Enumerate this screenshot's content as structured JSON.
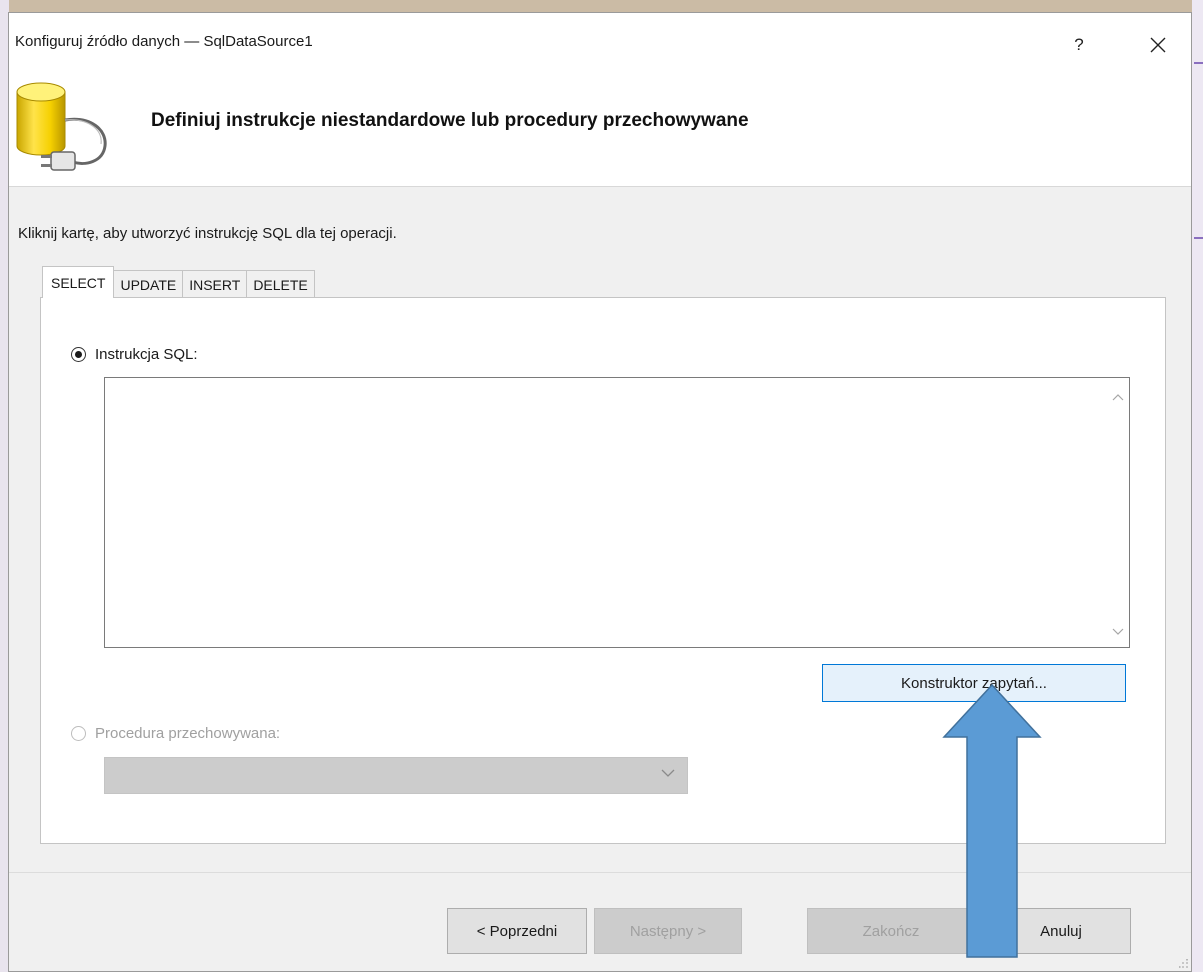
{
  "window": {
    "title": "Konfiguruj źródło danych — SqlDataSource1",
    "help_label": "?",
    "close_icon": "close-icon"
  },
  "header": {
    "title": "Definiuj instrukcje niestandardowe lub procedury przechowywane",
    "icon": "database-plug-icon"
  },
  "instruction": "Kliknij kartę, aby utworzyć instrukcję SQL dla tej operacji.",
  "tabs": [
    {
      "label": "SELECT",
      "active": true
    },
    {
      "label": "UPDATE",
      "active": false
    },
    {
      "label": "INSERT",
      "active": false
    },
    {
      "label": "DELETE",
      "active": false
    }
  ],
  "select_tab": {
    "sql_option_label": "Instrukcja SQL:",
    "sql_option_checked": true,
    "sql_text": "",
    "query_builder_label": "Konstruktor zapytań...",
    "proc_option_label": "Procedura przechowywana:",
    "proc_option_checked": false,
    "proc_selected": ""
  },
  "footer": {
    "prev_label": "< Poprzedni",
    "next_label": "Następny >",
    "finish_label": "Zakończ",
    "cancel_label": "Anuluj"
  },
  "colors": {
    "accent": "#0078d7",
    "annotation_arrow": "#5b9bd5",
    "dialog_bg": "#f0f0f0"
  }
}
